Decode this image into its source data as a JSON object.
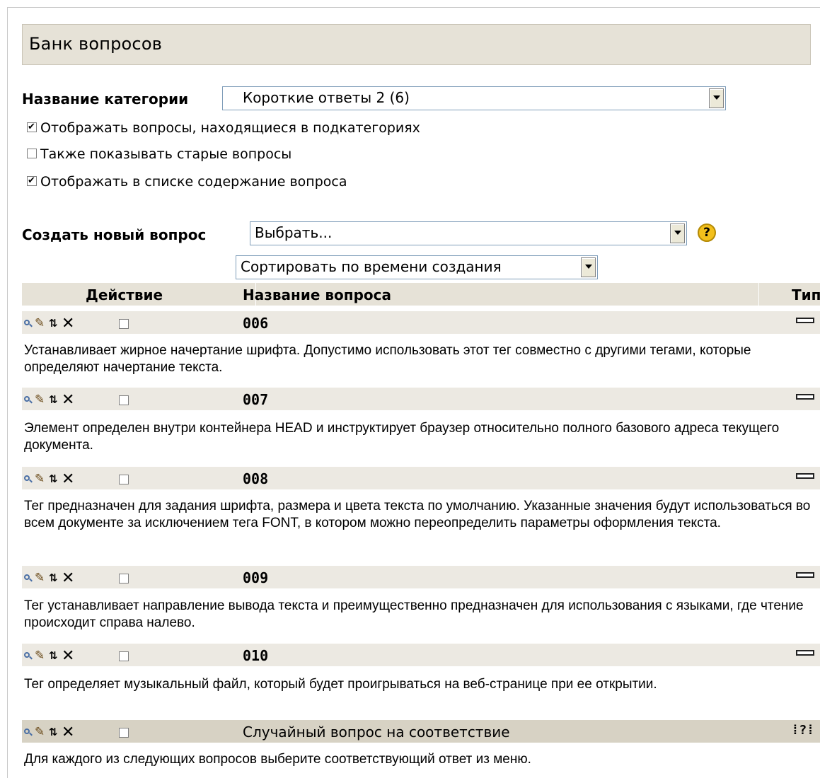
{
  "heading": "Банк вопросов",
  "category": {
    "label": "Название категории",
    "value": "Короткие ответы 2 (6)"
  },
  "options": [
    {
      "label": "Отображать вопросы, находящиеся в подкатегориях",
      "checked": true
    },
    {
      "label": "Также показывать старые вопросы",
      "checked": false
    },
    {
      "label": "Отображать в списке содержание вопроса",
      "checked": true
    }
  ],
  "create": {
    "label": "Создать новый вопрос",
    "value": "Выбрать...",
    "help_icon": "?"
  },
  "sort": {
    "value": "Сортировать по времени создания"
  },
  "table": {
    "headers": {
      "action": "Действие",
      "name": "Название вопроса",
      "type": "Тип"
    },
    "rows": [
      {
        "name": "006",
        "type": "short-answer-icon",
        "description": "Устанавливает жирное начертание шрифта. Допустимо использовать этот тег совместно с другими тегами, которые определяют начертание текста."
      },
      {
        "name": "007",
        "type": "short-answer-icon",
        "description": "Элемент определен внутри контейнера HEAD и инструктирует браузер относительно полного базового адреса текущего документа."
      },
      {
        "name": "008",
        "type": "short-answer-icon",
        "description": "Тег предназначен для задания шрифта, размера и цвета текста по умолчанию. Указанные значения будут использоваться во всем документе за исключением тега FONT, в котором можно переопределить параметры оформления текста."
      },
      {
        "name": "009",
        "type": "short-answer-icon",
        "description": "Тег устанавливает направление вывода текста и преимущественно предназначен для использования с языками, где чтение происходит справа налево."
      },
      {
        "name": "010",
        "type": "short-answer-icon",
        "description": "Тег определяет музыкальный файл, который будет проигрываться на веб-странице при ее открытии."
      },
      {
        "name": "Случайный вопрос на соответствие",
        "type": "random-match-icon",
        "type_glyph": "⁞?⁞",
        "description": "Для каждого из следующих вопросов выберите соответствующий ответ из меню."
      }
    ]
  }
}
